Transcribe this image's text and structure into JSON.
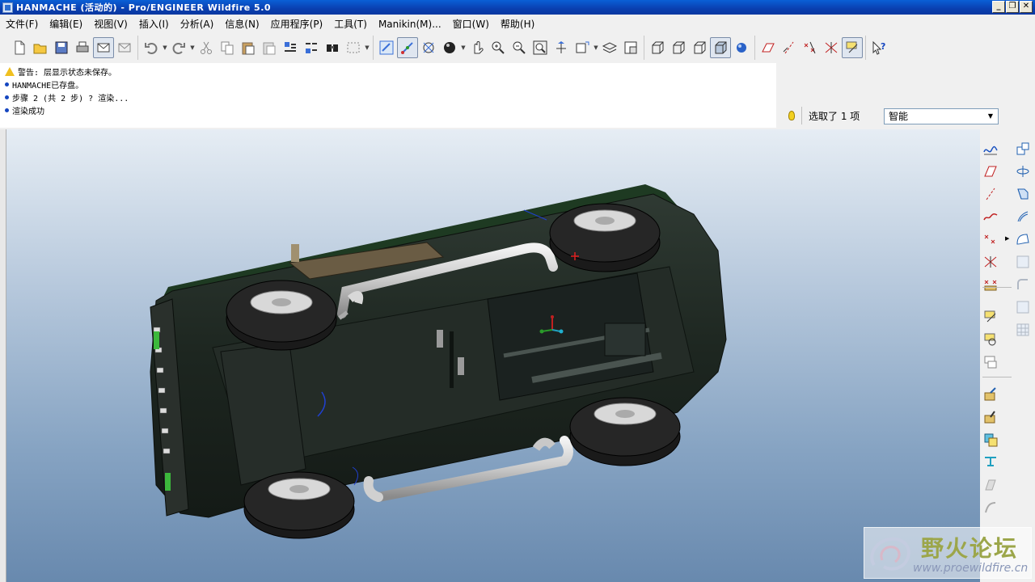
{
  "window": {
    "title": "HANMACHE (活动的) - Pro/ENGINEER Wildfire 5.0",
    "controls": [
      "_",
      "❐",
      "✕"
    ]
  },
  "menubar": {
    "items": [
      "文件(F)",
      "编辑(E)",
      "视图(V)",
      "插入(I)",
      "分析(A)",
      "信息(N)",
      "应用程序(P)",
      "工具(T)",
      "Manikin(M)...",
      "窗口(W)",
      "帮助(H)"
    ]
  },
  "toolbar": {
    "icons": [
      "new-file-icon",
      "open-folder-icon",
      "save-icon",
      "print-icon",
      "email-icon",
      "email-link-icon",
      "undo-icon",
      "redo-icon",
      "cut-icon",
      "copy-icon",
      "paste-icon",
      "paste-special-icon",
      "regenerate-icon",
      "regen-manager-icon",
      "find-icon",
      "select-box-icon",
      "redraw-icon",
      "spin-center-icon",
      "orient-mode-icon",
      "appearance-icon",
      "pan-icon",
      "zoom-in-icon",
      "zoom-out-icon",
      "refit-icon",
      "reorient-icon",
      "saved-views-icon",
      "layers-icon",
      "view-manager-icon",
      "wireframe-icon",
      "hidden-line-icon",
      "no-hidden-icon",
      "shading-icon",
      "enhanced-realism-icon",
      "datum-planes-icon",
      "datum-axes-icon",
      "datum-points-icon",
      "csys-icon",
      "annotation-icon",
      "whats-this-icon"
    ]
  },
  "messages": [
    {
      "type": "warning",
      "text": "警告: 层显示状态未保存。"
    },
    {
      "type": "info",
      "text": "HANMACHE已存盘。"
    },
    {
      "type": "info",
      "text": "步骤 2 (共 2 步) ? 渲染..."
    },
    {
      "type": "info",
      "text": "渲染成功"
    }
  ],
  "selection": {
    "status": "选取了 1 项",
    "filter_value": "智能"
  },
  "right_toolbar": {
    "icons": [
      "sketch-icon",
      "datum-plane-icon",
      "datum-axis-icon",
      "datum-curve-icon",
      "datum-point-icon",
      "datum-csys-icon",
      "analysis-icon",
      "extrude-icon",
      "revolve-icon",
      "variable-section-sweep-icon",
      "boundary-blend-icon",
      "style-icon",
      "hole-icon",
      "round-icon",
      "shell-icon",
      "draft-icon",
      "rib-icon",
      "pattern-icon",
      "mirror-icon",
      "merge-icon",
      "trim-icon",
      "extend-icon",
      "offset-icon",
      "thicken-icon",
      "solidify-icon"
    ]
  },
  "watermark": {
    "title": "野火论坛",
    "url": "www.proewildfire.cn"
  },
  "colors": {
    "titlebar": "#0a46c0",
    "viewport_top": "#e6edf4",
    "viewport_bottom": "#6889ae",
    "car_body": "#1f2a24"
  }
}
